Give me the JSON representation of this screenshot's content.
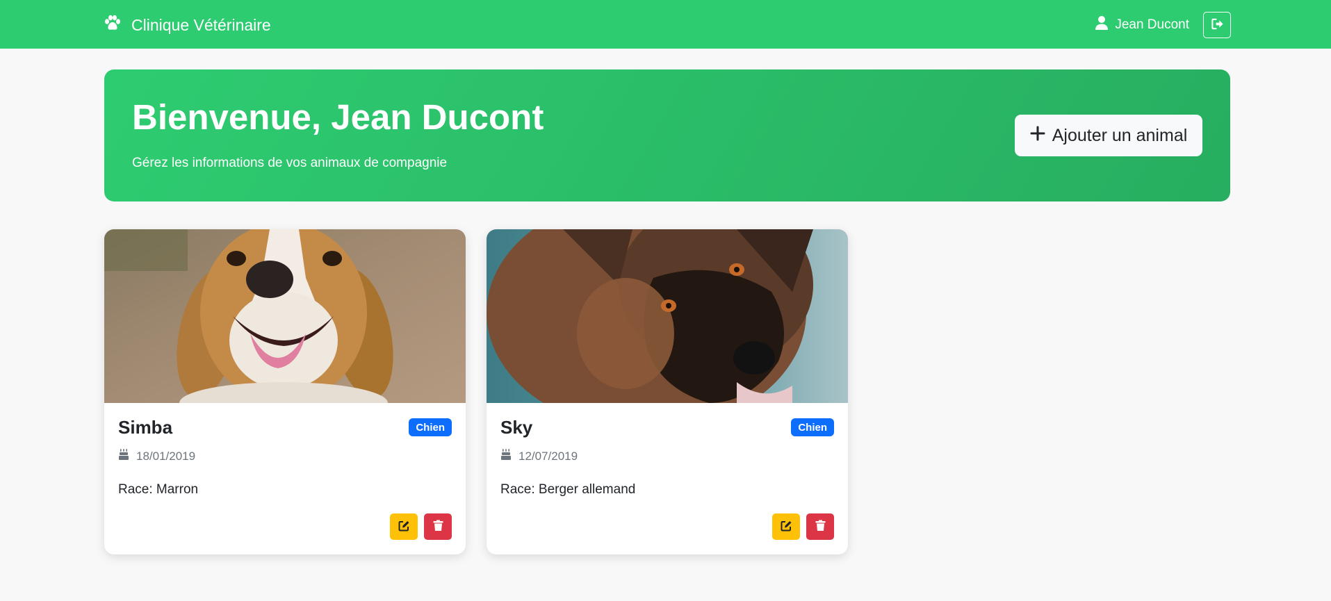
{
  "navbar": {
    "brand_icon": "paw-icon",
    "brand": "Clinique Vétérinaire",
    "user_icon": "user-icon",
    "user_name": "Jean Ducont",
    "logout_icon": "sign-out-icon"
  },
  "hero": {
    "title": "Bienvenue, Jean Ducont",
    "subtitle": "Gérez les informations de vos animaux de compagnie",
    "add_button_icon": "plus-icon",
    "add_button": "Ajouter un animal"
  },
  "pets": [
    {
      "name": "Simba",
      "species": "Chien",
      "birth_icon": "birthday-cake-icon",
      "birthdate": "18/01/2019",
      "race": "Race: Marron",
      "photo": "beagle-dog-photo"
    },
    {
      "name": "Sky",
      "species": "Chien",
      "birth_icon": "birthday-cake-icon",
      "birthdate": "12/07/2019",
      "race": "Race: Berger allemand",
      "photo": "german-shepherd-dog-photo"
    }
  ],
  "colors": {
    "primary_green": "#2ecc71",
    "dark_green": "#27ae60",
    "badge_blue": "#0d6efd",
    "edit_yellow": "#ffc107",
    "delete_red": "#dc3545",
    "page_bg": "#f8f8f8"
  }
}
